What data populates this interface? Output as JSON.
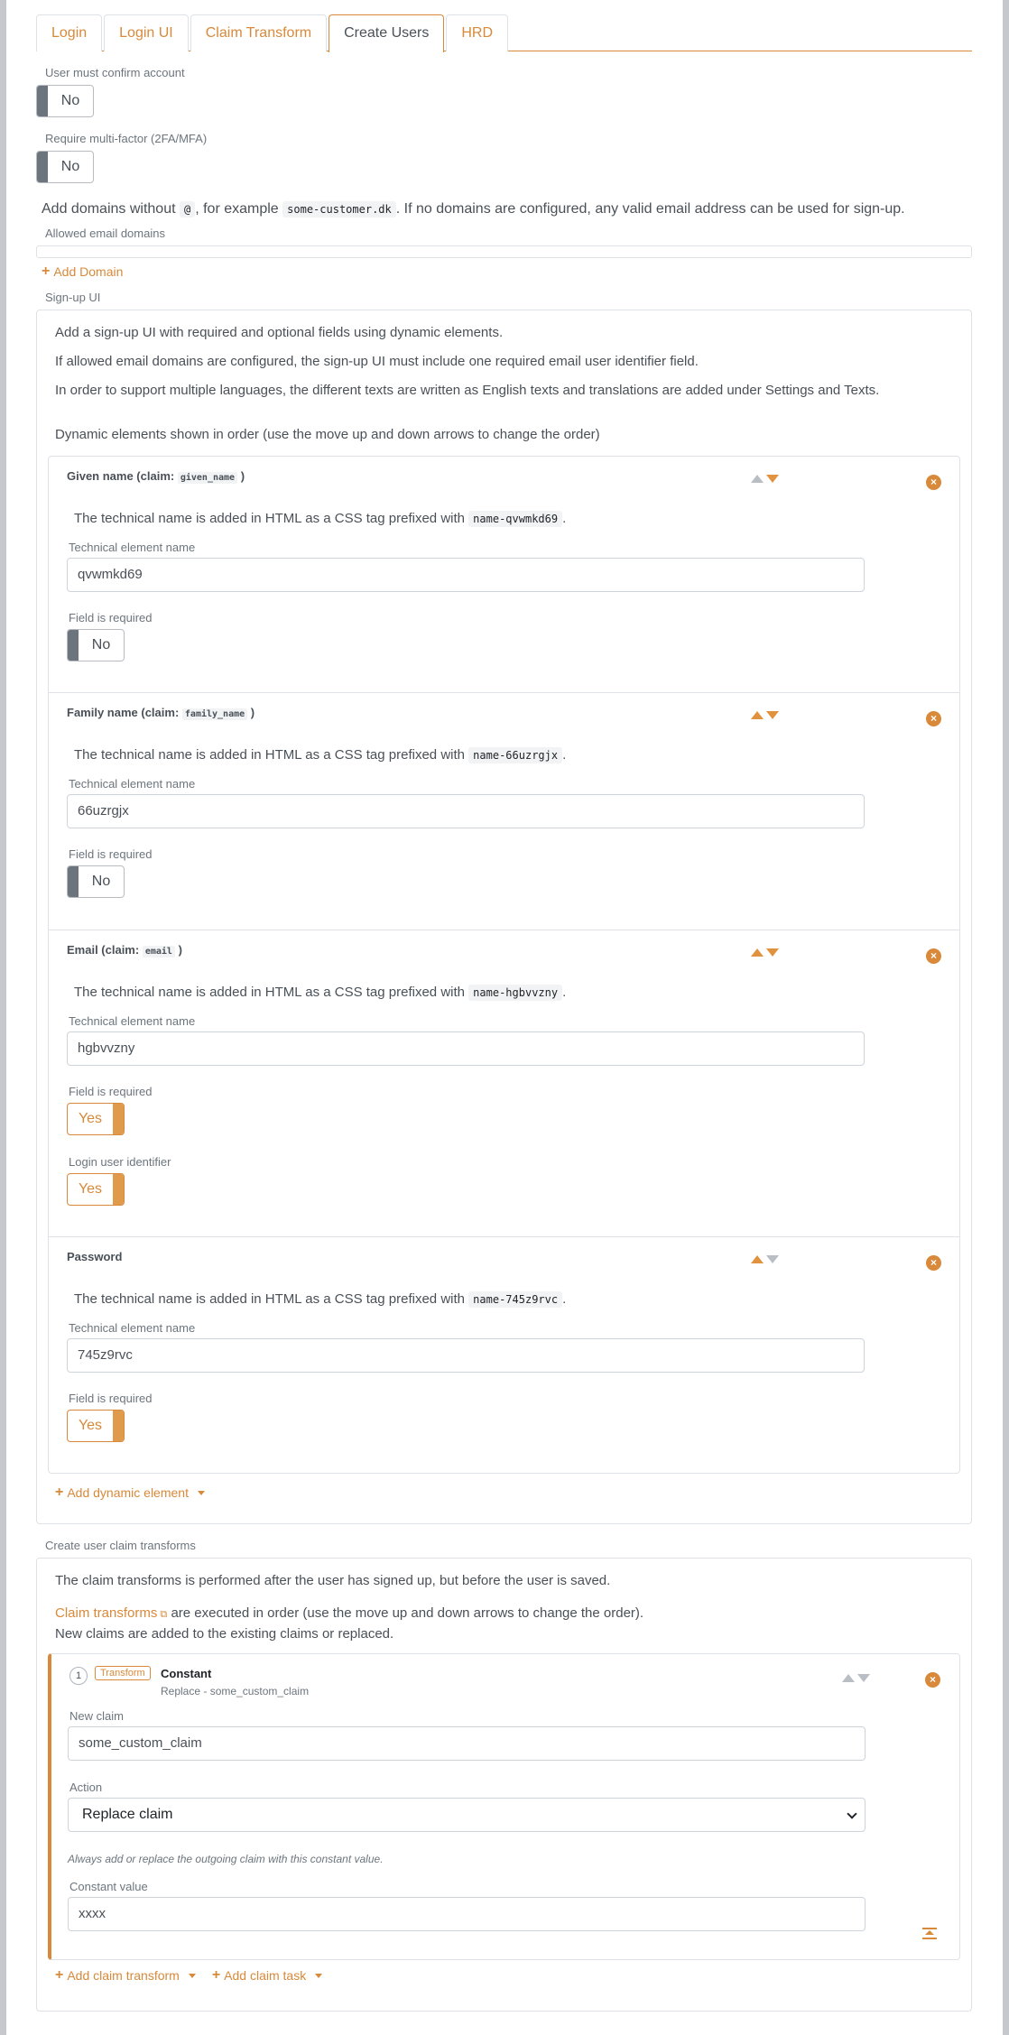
{
  "tabs": [
    {
      "label": "Login"
    },
    {
      "label": "Login UI"
    },
    {
      "label": "Claim Transform"
    },
    {
      "label": "Create Users"
    },
    {
      "label": "HRD"
    }
  ],
  "confirm_account": {
    "label": "User must confirm account",
    "value": "No"
  },
  "mfa": {
    "label": "Require multi-factor (2FA/MFA)",
    "value": "No"
  },
  "domains": {
    "hint_before": "Add domains without",
    "hint_at": "@",
    "hint_mid": ", for example",
    "hint_example": "some-customer.dk",
    "hint_after": ". If no domains are configured, any valid email address can be used for sign-up.",
    "label": "Allowed email domains",
    "add_label": "Add Domain"
  },
  "signup": {
    "section_label": "Sign-up UI",
    "p1": "Add a sign-up UI with required and optional fields using dynamic elements.",
    "p2": "If allowed email domains are configured, the sign-up UI must include one required email user identifier field.",
    "p3": "In order to support multiple languages, the different texts are written as English texts and translations are added under Settings and Texts.",
    "p4": "Dynamic elements shown in order (use the move up and down arrows to change the order)",
    "tech_hint": "The technical name is added in HTML as a CSS tag prefixed with",
    "tech_label": "Technical element name",
    "required_label": "Field is required",
    "login_id_label": "Login user identifier",
    "add_element": "Add dynamic element",
    "elements": [
      {
        "title": "Given name (claim:",
        "claim": "given_name",
        "close": ")",
        "prefix": "name-qvwmkd69",
        "name": "qvwmkd69",
        "required": "No"
      },
      {
        "title": "Family name (claim:",
        "claim": "family_name",
        "close": ")",
        "prefix": "name-66uzrgjx",
        "name": "66uzrgjx",
        "required": "No"
      },
      {
        "title": "Email (claim:",
        "claim": "email",
        "close": ")",
        "prefix": "name-hgbvvzny",
        "name": "hgbvvzny",
        "required": "Yes",
        "login_id": "Yes"
      },
      {
        "title": "Password",
        "prefix": "name-745z9rvc",
        "name": "745z9rvc",
        "required": "Yes"
      }
    ]
  },
  "transforms": {
    "section_label": "Create user claim transforms",
    "p1": "The claim transforms is performed after the user has signed up, but before the user is saved.",
    "link": "Claim transforms",
    "p2_rest": " are executed in order (use the move up and down arrows to change the order).",
    "p3": "New claims are added to the existing claims or replaced.",
    "item": {
      "number": "1",
      "badge": "Transform",
      "type": "Constant",
      "subtitle": "Replace - some_custom_claim",
      "new_claim_label": "New claim",
      "new_claim": "some_custom_claim",
      "action_label": "Action",
      "action": "Replace claim",
      "note": "Always add or replace the outgoing claim with this constant value.",
      "constant_label": "Constant value",
      "constant": "xxxx"
    },
    "add_transform": "Add claim transform",
    "add_task": "Add claim task"
  },
  "colors": {
    "accent": "#d8893a",
    "border": "#dee2e6",
    "text": "#495057"
  }
}
